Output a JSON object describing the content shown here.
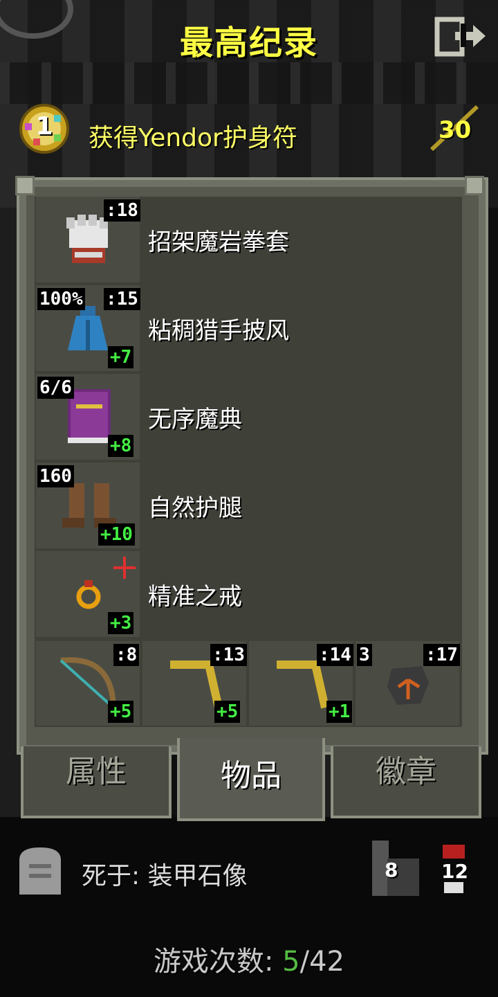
{
  "header": {
    "title": "最高纪录",
    "exit_icon": "exit-icon"
  },
  "record": {
    "rank": "1",
    "description": "获得Yendor护身符",
    "level": "30",
    "rank_badge_icon": "rank-medal-icon",
    "level_icon": "wand-icon"
  },
  "items": [
    {
      "name": "招架魔岩拳套",
      "icon": "gauntlet-icon",
      "top_left": "",
      "top_right": ":18",
      "bonus": ""
    },
    {
      "name": "粘稠猎手披风",
      "icon": "cloak-icon",
      "top_left": "100%",
      "top_right": ":15",
      "bonus": "+7"
    },
    {
      "name": "无序魔典",
      "icon": "spellbook-icon",
      "top_left": "6/6",
      "top_right": "",
      "bonus": "+8"
    },
    {
      "name": "自然护腿",
      "icon": "boots-icon",
      "top_left": "160",
      "top_right": "",
      "bonus": "+10"
    },
    {
      "name": "精准之戒",
      "icon": "ring-icon",
      "top_left": "",
      "top_right": "",
      "bonus": "+3"
    }
  ],
  "quickslots": [
    {
      "icon": "bow-icon",
      "top_left": "",
      "top_right": ":8",
      "bonus": "+5"
    },
    {
      "icon": "boomerang-icon",
      "top_left": "",
      "top_right": ":13",
      "bonus": "+5"
    },
    {
      "icon": "boomerang-icon",
      "top_left": "",
      "top_right": ":14",
      "bonus": "+1"
    },
    {
      "icon": "bomb-icon",
      "top_left": "3",
      "top_right": ":17",
      "bonus": ""
    }
  ],
  "tabs": {
    "stats": "属性",
    "items": "物品",
    "badges": "徽章",
    "active": "items"
  },
  "death": {
    "text": "死于: 装甲石像",
    "depth": "8",
    "ascension": "12",
    "tomb_icon": "tombstone-icon",
    "depth_icon": "stairs-icon",
    "ascension_icon": "skull-icon"
  },
  "games": {
    "label": "游戏次数: ",
    "won": "5",
    "separator": "/",
    "total": "42"
  },
  "colors": {
    "title": "#ffff44",
    "bonus": "#44ee44",
    "won": "#55bb44",
    "panel": "#57594f"
  }
}
